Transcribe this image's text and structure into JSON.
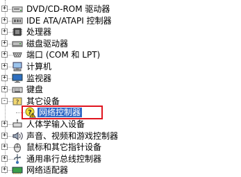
{
  "tree": {
    "items": [
      {
        "label": "DVD/CD-ROM 驱动器",
        "expanded": false,
        "icon": "dvd-drive-icon"
      },
      {
        "label": "IDE ATA/ATAPI 控制器",
        "expanded": false,
        "icon": "ide-controller-icon"
      },
      {
        "label": "处理器",
        "expanded": false,
        "icon": "processor-icon"
      },
      {
        "label": "磁盘驱动器",
        "expanded": false,
        "icon": "disk-drive-icon"
      },
      {
        "label": "端口 (COM 和 LPT)",
        "expanded": false,
        "icon": "port-icon"
      },
      {
        "label": "计算机",
        "expanded": false,
        "icon": "computer-icon"
      },
      {
        "label": "监视器",
        "expanded": false,
        "icon": "monitor-icon"
      },
      {
        "label": "键盘",
        "expanded": false,
        "icon": "keyboard-icon"
      },
      {
        "label": "其它设备",
        "expanded": true,
        "icon": "other-devices-icon"
      },
      {
        "label": "人体学输入设备",
        "expanded": false,
        "icon": "hid-icon"
      },
      {
        "label": "声音、视频和游戏控制器",
        "expanded": false,
        "icon": "sound-video-icon"
      },
      {
        "label": "鼠标和其它指针设备",
        "expanded": false,
        "icon": "mouse-icon"
      },
      {
        "label": "通用串行总线控制器",
        "expanded": false,
        "icon": "usb-icon"
      },
      {
        "label": "网络适配器",
        "expanded": false,
        "icon": "network-adapter-icon"
      }
    ],
    "child": {
      "label": "网络控制器",
      "icon": "unknown-device-warning-icon",
      "selected": true
    }
  },
  "colors": {
    "selection": "#3169c6",
    "highlight_box": "#e0141e",
    "tree_lines": "#9a9a9a"
  },
  "toggle_symbols": {
    "collapsed": "+",
    "expanded": "-"
  }
}
